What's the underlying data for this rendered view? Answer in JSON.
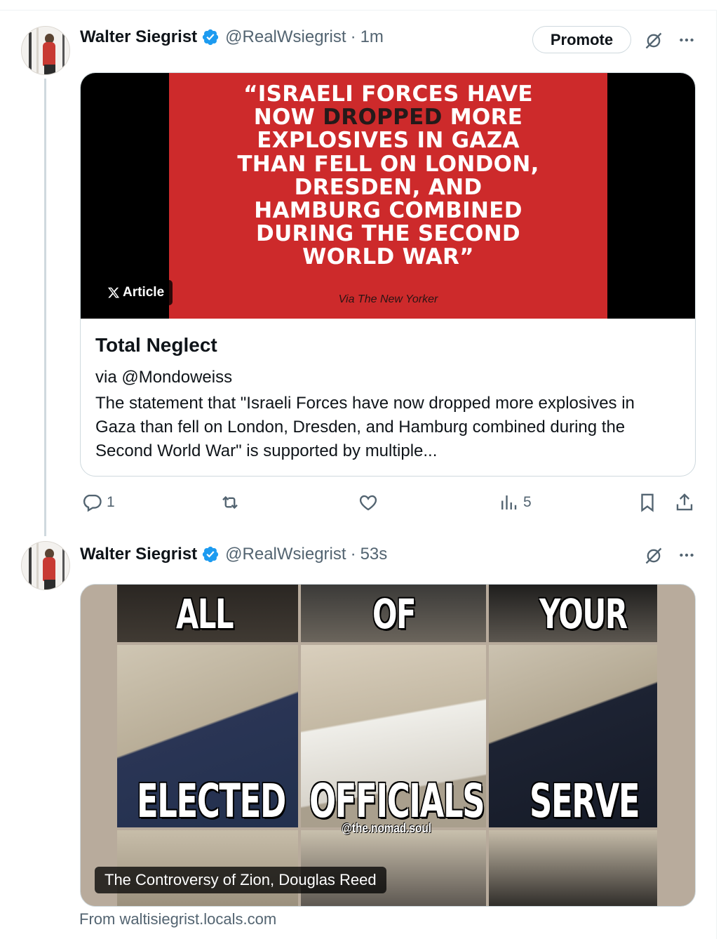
{
  "tweets": [
    {
      "author_name": "Walter Siegrist",
      "handle": "@RealWsiegrist",
      "separator": "·",
      "time": "1m",
      "promote_label": "Promote",
      "card": {
        "quote_line1": "“ISRAELI FORCES HAVE",
        "quote_line2a": "NOW ",
        "quote_line2b": "DROPPED",
        "quote_line2c": " MORE",
        "quote_line3": "EXPLOSIVES IN GAZA",
        "quote_line4": "THAN FELL ON LONDON,",
        "quote_line5": "DRESDEN, AND",
        "quote_line6": "HAMBURG COMBINED",
        "quote_line7": "DURING THE SECOND",
        "quote_line8": "WORLD WAR”",
        "credit": "Via The New Yorker",
        "badge_label": "Article",
        "title": "Total Neglect",
        "subtitle": "via @Mondoweiss",
        "description": "The statement that \"Israeli Forces have now dropped more explosives in Gaza than fell on London, Dresden, and Hamburg combined during the Second World War\" is supported by multiple..."
      },
      "actions": {
        "replies": "1",
        "views": "5"
      }
    },
    {
      "author_name": "Walter Siegrist",
      "handle": "@RealWsiegrist",
      "separator": "·",
      "time": "53s",
      "meme": {
        "top_words": [
          "ALL",
          "OF",
          "YOUR"
        ],
        "bottom_words": [
          "ELECTED",
          "OFFICIALS",
          "SERVE"
        ],
        "watermark": "@the.nomad.soul"
      },
      "caption": "The Controversy of Zion, Douglas Reed",
      "source": "From waltisiegrist.locals.com"
    }
  ],
  "colors": {
    "verified_blue": "#1d9bf0",
    "muted_text": "#536471",
    "quote_red": "#cd2a2b"
  },
  "icons": [
    "verified-badge-icon",
    "grok-icon",
    "more-icon",
    "reply-icon",
    "retweet-icon",
    "like-icon",
    "views-icon",
    "bookmark-icon",
    "share-icon",
    "x-logo-icon"
  ]
}
